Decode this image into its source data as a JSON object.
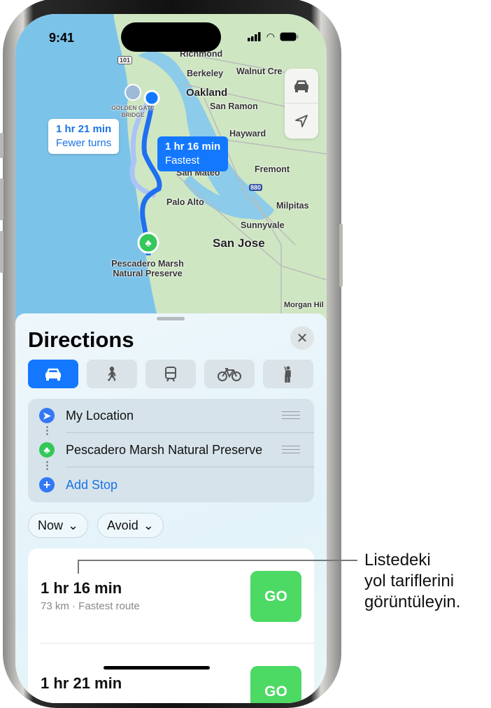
{
  "status_bar": {
    "time": "9:41"
  },
  "map": {
    "labels": {
      "richmond": "Richmond",
      "berkeley": "Berkeley",
      "walnut_creek": "Walnut Cre",
      "oakland": "Oakland",
      "san_ramon": "San Ramon",
      "hayward": "Hayward",
      "fremont": "Fremont",
      "san_mateo": "San Mateo",
      "palo_alto": "Palo Alto",
      "milpitas": "Milpitas",
      "sunnyvale": "Sunnyvale",
      "san_jose": "San Jose",
      "morgan_hill": "Morgan Hil",
      "golden_gate": "GOLDEN GATE BRIDGE",
      "destination": "Pescadero Marsh Natural Preserve",
      "hwy_101": "101",
      "hwy_880": "880"
    },
    "route_alt": {
      "time": "1 hr 21 min",
      "desc": "Fewer turns"
    },
    "route_fast": {
      "time": "1 hr 16 min",
      "desc": "Fastest"
    },
    "controls": [
      "car-icon",
      "location-arrow-icon"
    ]
  },
  "sheet": {
    "title": "Directions",
    "modes": [
      {
        "icon": "car-icon",
        "active": true
      },
      {
        "icon": "walk-icon"
      },
      {
        "icon": "transit-icon"
      },
      {
        "icon": "bike-icon"
      },
      {
        "icon": "rideshare-icon"
      }
    ],
    "stops": [
      {
        "label": "My Location"
      },
      {
        "label": "Pescadero Marsh Natural Preserve"
      }
    ],
    "add_stop": "Add Stop",
    "filters": {
      "now": "Now",
      "avoid": "Avoid"
    },
    "routes": [
      {
        "time": "1 hr 16 min",
        "detail": "73 km · Fastest route",
        "go": "GO"
      },
      {
        "time": "1 hr 21 min",
        "go": "GO"
      }
    ]
  },
  "colors": {
    "accent": "#1478ff",
    "go": "#4cd964",
    "destination": "#34c759"
  },
  "callout": {
    "line1": "Listedeki",
    "line2": "yol tariflerini",
    "line3": "görüntüleyin."
  }
}
